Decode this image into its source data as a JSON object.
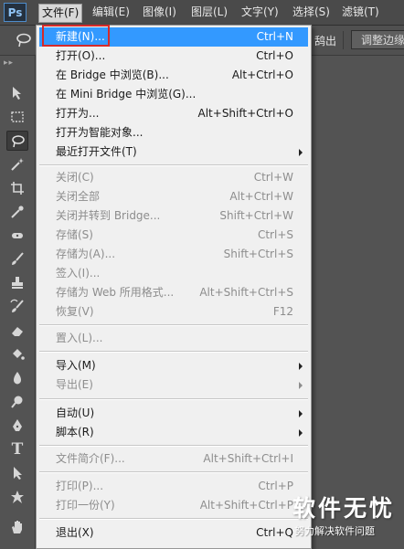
{
  "app": {
    "logo": "Ps"
  },
  "menubar": {
    "items": [
      "文件(F)",
      "编辑(E)",
      "图像(I)",
      "图层(L)",
      "文字(Y)",
      "选择(S)",
      "滤镜(T)"
    ]
  },
  "options": {
    "partial_label": "鸹出",
    "refine_button": "调整边缘"
  },
  "toolbar": {
    "tools": [
      "move-tool",
      "marquee-tool",
      "lasso-tool",
      "magic-wand-tool",
      "crop-tool",
      "eyedropper-tool",
      "healing-brush-tool",
      "brush-tool",
      "clone-stamp-tool",
      "history-brush-tool",
      "eraser-tool",
      "paint-bucket-tool",
      "blur-tool",
      "dodge-tool",
      "pen-tool",
      "type-tool",
      "path-selection-tool",
      "shape-tool",
      "hand-tool"
    ]
  },
  "file_menu": {
    "items": [
      {
        "label": "新建(N)...",
        "shortcut": "Ctrl+N"
      },
      {
        "label": "打开(O)...",
        "shortcut": "Ctrl+O"
      },
      {
        "label": "在 Bridge 中浏览(B)...",
        "shortcut": "Alt+Ctrl+O"
      },
      {
        "label": "在 Mini Bridge 中浏览(G)...",
        "shortcut": ""
      },
      {
        "label": "打开为...",
        "shortcut": "Alt+Shift+Ctrl+O"
      },
      {
        "label": "打开为智能对象...",
        "shortcut": ""
      },
      {
        "label": "最近打开文件(T)",
        "shortcut": ""
      },
      {
        "label": "关闭(C)",
        "shortcut": "Ctrl+W"
      },
      {
        "label": "关闭全部",
        "shortcut": "Alt+Ctrl+W"
      },
      {
        "label": "关闭并转到 Bridge...",
        "shortcut": "Shift+Ctrl+W"
      },
      {
        "label": "存储(S)",
        "shortcut": "Ctrl+S"
      },
      {
        "label": "存储为(A)...",
        "shortcut": "Shift+Ctrl+S"
      },
      {
        "label": "签入(I)...",
        "shortcut": ""
      },
      {
        "label": "存储为 Web 所用格式...",
        "shortcut": "Alt+Shift+Ctrl+S"
      },
      {
        "label": "恢复(V)",
        "shortcut": "F12"
      },
      {
        "label": "置入(L)...",
        "shortcut": ""
      },
      {
        "label": "导入(M)",
        "shortcut": ""
      },
      {
        "label": "导出(E)",
        "shortcut": ""
      },
      {
        "label": "自动(U)",
        "shortcut": ""
      },
      {
        "label": "脚本(R)",
        "shortcut": ""
      },
      {
        "label": "文件简介(F)...",
        "shortcut": "Alt+Shift+Ctrl+I"
      },
      {
        "label": "打印(P)...",
        "shortcut": "Ctrl+P"
      },
      {
        "label": "打印一份(Y)",
        "shortcut": "Alt+Shift+Ctrl+P"
      },
      {
        "label": "退出(X)",
        "shortcut": "Ctrl+Q"
      }
    ]
  },
  "watermark": {
    "title": "软件无忧",
    "subtitle": "努力解决软件问题"
  },
  "colors": {
    "highlight": "#3399ff",
    "annotation": "#d62a2a"
  }
}
